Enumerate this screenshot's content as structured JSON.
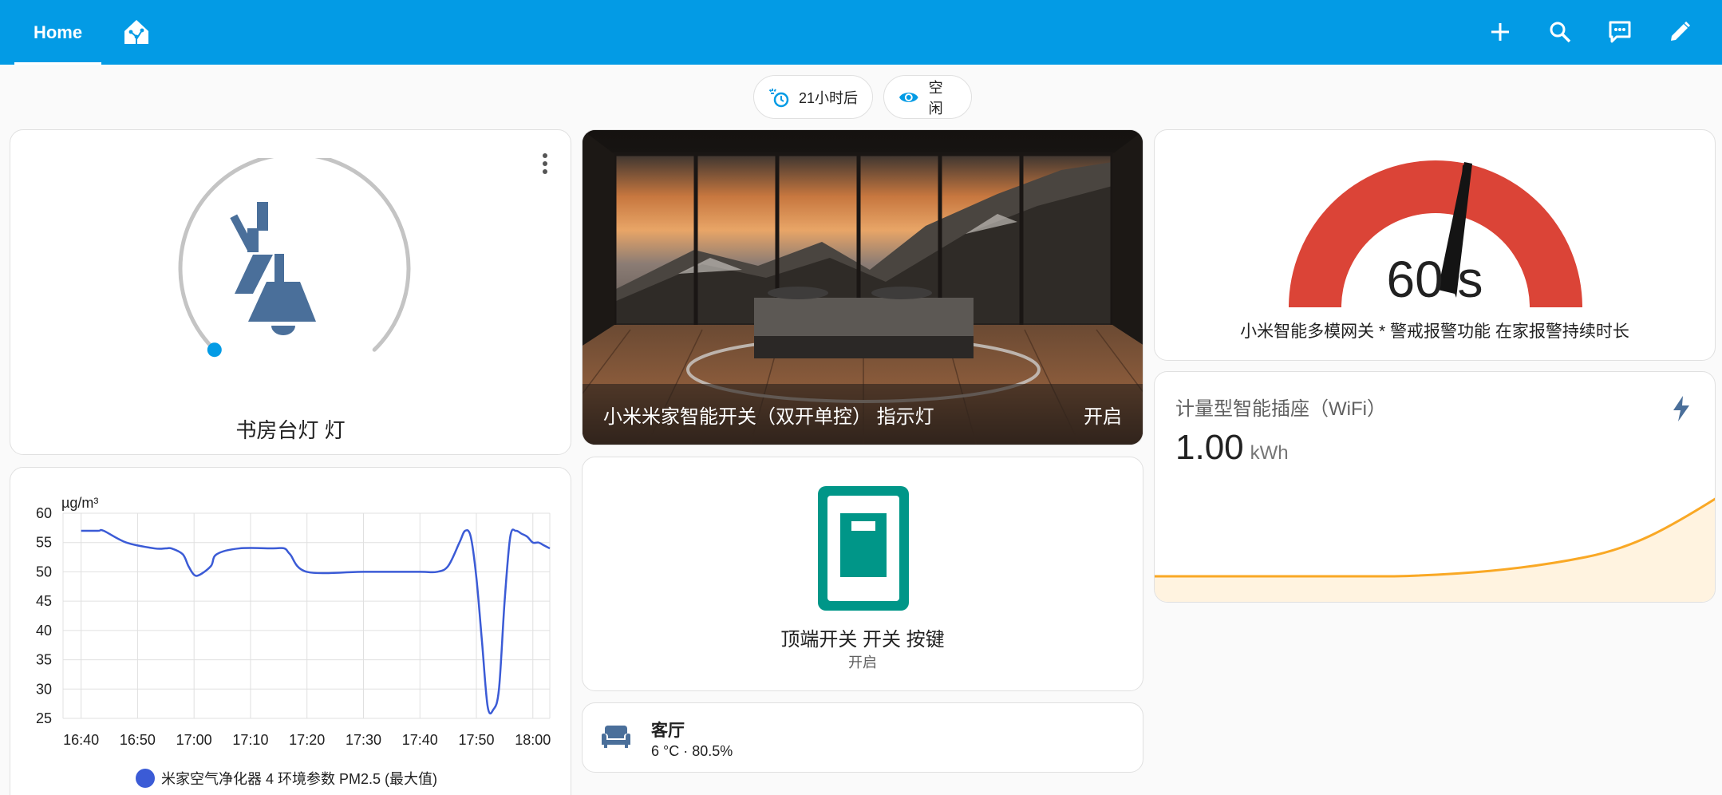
{
  "header": {
    "tab_home": "Home",
    "tab_icon": "home-assistant-icon",
    "actions": [
      "add-icon",
      "search-icon",
      "chat-icon",
      "edit-icon"
    ]
  },
  "badges": [
    {
      "icon": "weather-clock-icon",
      "label": "21小时后"
    },
    {
      "icon": "eye-icon",
      "label": "空闲"
    }
  ],
  "light_card": {
    "name": "书房台灯 灯",
    "icon": "desk-lamp-icon",
    "brightness_fraction": 0.0,
    "accent": "#4a6f9a"
  },
  "picture_card": {
    "title": "小米米家智能开关（双开单控） 指示灯",
    "state": "开启"
  },
  "gauge_card": {
    "value": "60 s",
    "value_number": 60,
    "min": 0,
    "max": 60,
    "label": "小米智能多模网关 * 警戒报警功能 在家报警持续时长",
    "color": "#db4437"
  },
  "energy_card": {
    "title": "计量型智能插座（WiFi）",
    "value": "1.00",
    "unit": "kWh",
    "icon": "flash-icon",
    "accent": "#f9a825"
  },
  "button_card": {
    "name": "顶端开关 开关 按键",
    "state": "开启",
    "icon": "switch-button-icon",
    "color": "#009688"
  },
  "area_card": {
    "name": "客厅",
    "detail": "6 °C · 80.5%",
    "icon": "sofa-icon"
  },
  "chart_data": {
    "type": "line",
    "ylabel": "µg/m³",
    "ylim": [
      25,
      60
    ],
    "yticks": [
      "25",
      "30",
      "35",
      "40",
      "45",
      "50",
      "55",
      "60"
    ],
    "xticks": [
      "16:40",
      "16:50",
      "17:00",
      "17:10",
      "17:20",
      "17:30",
      "17:40",
      "17:50",
      "18:00"
    ],
    "series": [
      {
        "name": "米家空气净化器 4 环境参数 PM2.5 (最大值)",
        "color": "#3b5bd6",
        "x": [
          "16:40",
          "16:43",
          "16:44",
          "16:48",
          "16:53",
          "16:55",
          "16:56",
          "16:58",
          "16:59",
          "17:00",
          "17:01",
          "17:03",
          "17:04",
          "17:08",
          "17:14",
          "17:16",
          "17:17",
          "17:20",
          "17:30",
          "17:40",
          "17:43",
          "17:45",
          "17:47",
          "17:48",
          "17:49",
          "17:50",
          "17:51",
          "17:52",
          "17:53",
          "17:54",
          "17:55",
          "17:56",
          "17:57",
          "17:58",
          "17:59",
          "18:00",
          "18:01",
          "18:02",
          "18:03"
        ],
        "y": [
          57,
          57,
          57,
          55,
          54,
          54,
          54,
          53,
          51,
          49.5,
          49.5,
          51,
          53,
          54,
          54,
          54,
          53,
          50,
          50,
          50,
          50,
          51,
          55,
          57,
          56,
          49,
          38,
          27,
          26.5,
          30,
          45,
          56,
          57,
          56.5,
          56,
          55,
          55,
          54.5,
          54
        ]
      }
    ]
  }
}
